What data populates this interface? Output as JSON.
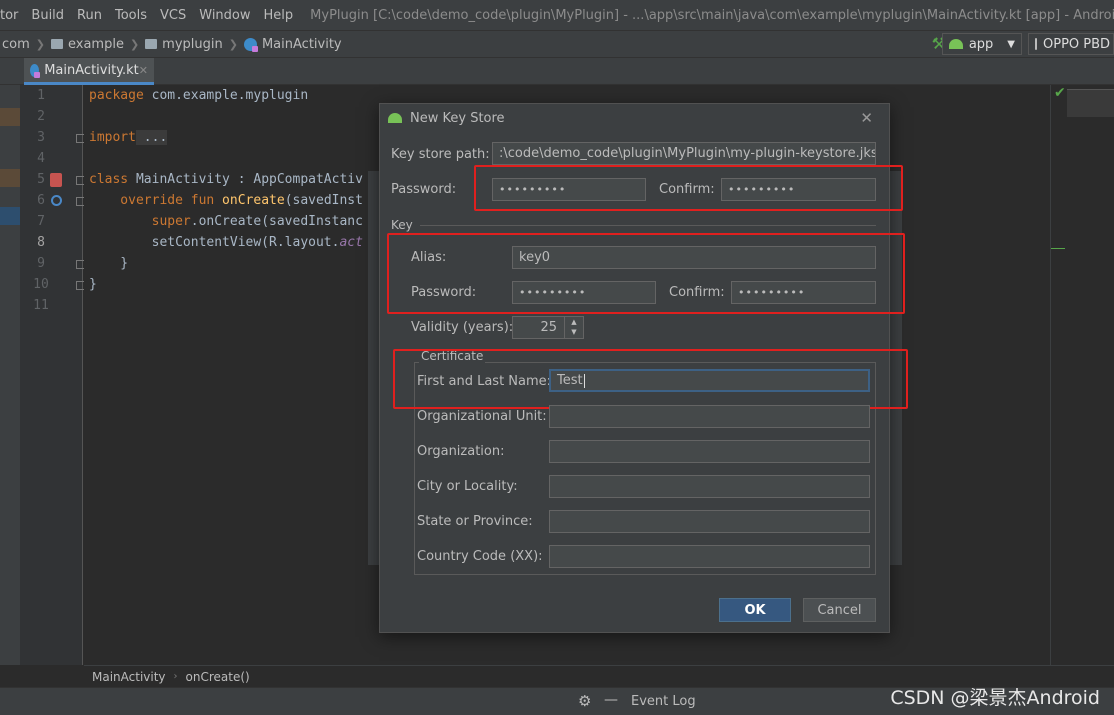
{
  "menu": {
    "items": [
      "tor",
      "Build",
      "Run",
      "Tools",
      "VCS",
      "Window",
      "Help"
    ],
    "window_title": "MyPlugin [C:\\code\\demo_code\\plugin\\MyPlugin] - ...\\app\\src\\main\\java\\com\\example\\myplugin\\MainActivity.kt [app] - Android Studio"
  },
  "nav": {
    "crumbs": [
      "com",
      "example",
      "myplugin",
      "MainActivity"
    ],
    "run_config": "app",
    "device": "OPPO PBD"
  },
  "tabs": [
    {
      "label": "MainActivity.kt"
    }
  ],
  "editor": {
    "line_numbers": [
      "1",
      "2",
      "3",
      "4",
      "5",
      "6",
      "7",
      "8",
      "9",
      "10",
      "11"
    ],
    "lines": [
      {
        "k": "package",
        "t": " com.example.myplugin"
      },
      {
        "t": ""
      },
      {
        "k": "import",
        "t": " ..."
      },
      {
        "t": ""
      },
      {
        "k": "class",
        "t": " MainActivity : AppCompatActiv"
      },
      {
        "k": "    override fun",
        "f": " onCreate",
        "t": "(savedInst"
      },
      {
        "k": "        super",
        "t": ".onCreate(savedInstanc"
      },
      {
        "t": "        setContentView(R.layout.",
        "i": "act"
      },
      {
        "t": "    }"
      },
      {
        "t": "}"
      }
    ]
  },
  "dialog": {
    "title": "New Key Store",
    "key_store_path_label": "Key store path:",
    "key_store_path_value": ":\\code\\demo_code\\plugin\\MyPlugin\\my-plugin-keystore.jks",
    "password_label": "Password:",
    "password_value": "•••••••••",
    "confirm_label": "Confirm:",
    "confirm_value": "•••••••••",
    "key_group_label": "Key",
    "alias_label": "Alias:",
    "alias_value": "key0",
    "key_password_label": "Password:",
    "key_password_value": "•••••••••",
    "key_confirm_label": "Confirm:",
    "key_confirm_value": "•••••••••",
    "validity_label": "Validity (years):",
    "validity_value": "25",
    "certificate_group_label": "Certificate",
    "first_last_label": "First and Last Name:",
    "first_last_value": "Test",
    "org_unit_label": "Organizational Unit:",
    "org_label": "Organization:",
    "city_label": "City or Locality:",
    "state_label": "State or Province:",
    "country_label": "Country Code (XX):",
    "ok_label": "OK",
    "cancel_label": "Cancel"
  },
  "breadcrumb": {
    "class_name": "MainActivity",
    "method": "onCreate()"
  },
  "status": {
    "event_log": "Event Log"
  },
  "watermark": "CSDN @梁景杰Android",
  "colors": {
    "highlight": "#e0201e",
    "ok_button": "#365880",
    "background": "#3c3f41"
  }
}
